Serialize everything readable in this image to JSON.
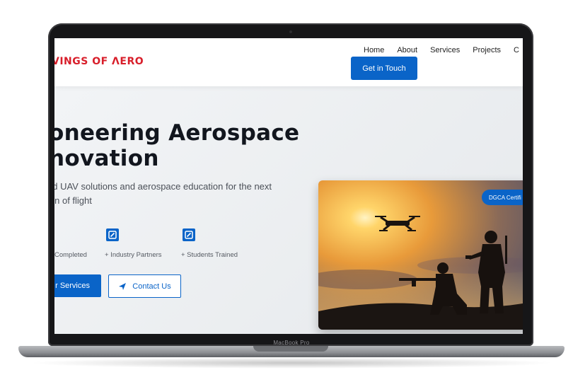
{
  "device": {
    "label": "MacBook Pro"
  },
  "site": {
    "logo_text": "VINGS OF ΛERO",
    "nav": {
      "links": [
        "Home",
        "About",
        "Services",
        "Projects",
        "C"
      ],
      "cta": "Get in Touch"
    },
    "hero": {
      "title_line1": "oneering Aerospace",
      "title_line2": "novation",
      "subtitle_line1": "ed UAV solutions and aerospace education for the next",
      "subtitle_line2": "ion of flight",
      "stats": [
        {
          "label": "Completed",
          "icon": "edit-icon"
        },
        {
          "label": "+ Industry Partners",
          "icon": "edit-icon"
        },
        {
          "label": "+ Students Trained",
          "icon": "edit-icon"
        }
      ],
      "primary_button": "r Services",
      "secondary_button": "Contact Us",
      "badge": "DGCA Certifi"
    }
  },
  "colors": {
    "accent": "#0a64c8",
    "logo": "#d81e2a"
  }
}
